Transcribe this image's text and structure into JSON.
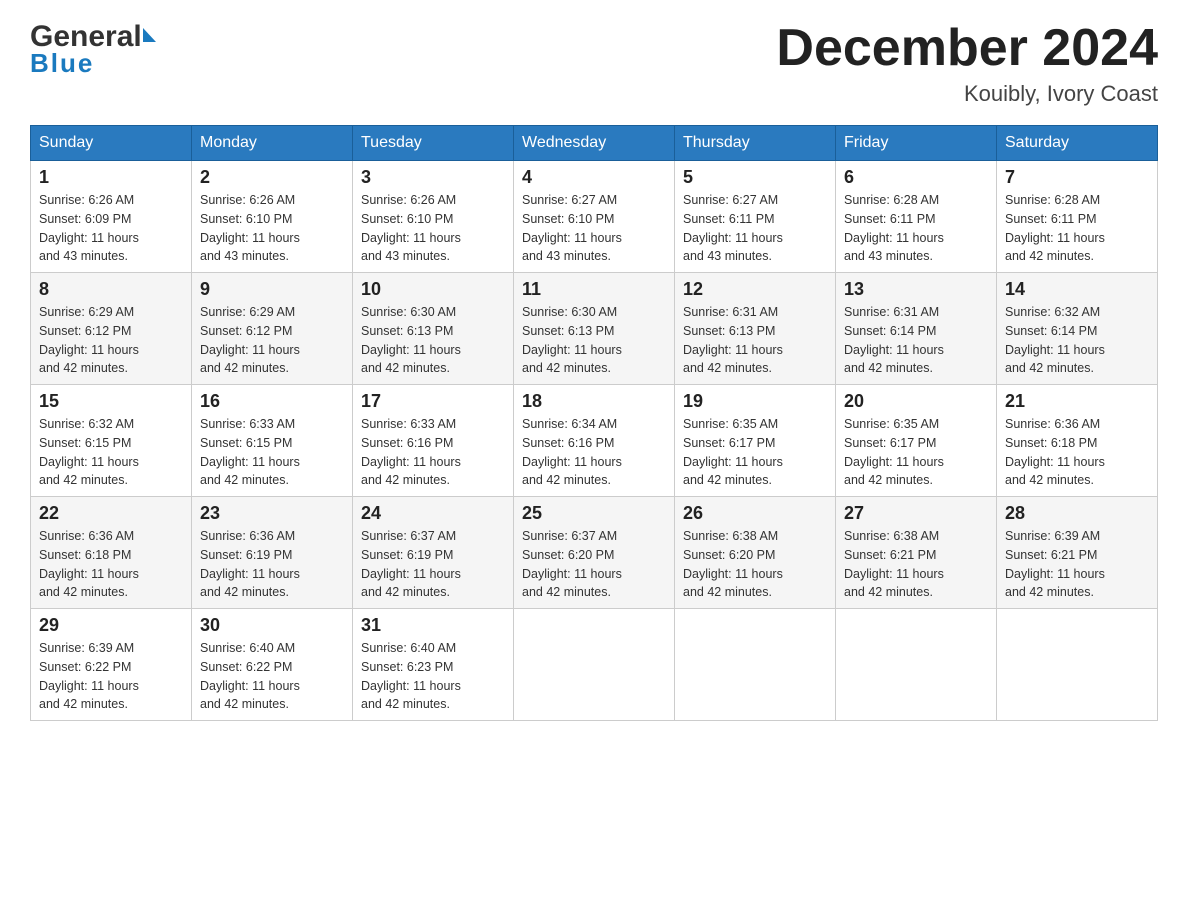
{
  "header": {
    "logo_general": "General",
    "logo_blue": "Blue",
    "title": "December 2024",
    "subtitle": "Kouibly, Ivory Coast"
  },
  "weekdays": [
    "Sunday",
    "Monday",
    "Tuesday",
    "Wednesday",
    "Thursday",
    "Friday",
    "Saturday"
  ],
  "weeks": [
    [
      {
        "day": "1",
        "sunrise": "6:26 AM",
        "sunset": "6:09 PM",
        "daylight": "11 hours and 43 minutes."
      },
      {
        "day": "2",
        "sunrise": "6:26 AM",
        "sunset": "6:10 PM",
        "daylight": "11 hours and 43 minutes."
      },
      {
        "day": "3",
        "sunrise": "6:26 AM",
        "sunset": "6:10 PM",
        "daylight": "11 hours and 43 minutes."
      },
      {
        "day": "4",
        "sunrise": "6:27 AM",
        "sunset": "6:10 PM",
        "daylight": "11 hours and 43 minutes."
      },
      {
        "day": "5",
        "sunrise": "6:27 AM",
        "sunset": "6:11 PM",
        "daylight": "11 hours and 43 minutes."
      },
      {
        "day": "6",
        "sunrise": "6:28 AM",
        "sunset": "6:11 PM",
        "daylight": "11 hours and 43 minutes."
      },
      {
        "day": "7",
        "sunrise": "6:28 AM",
        "sunset": "6:11 PM",
        "daylight": "11 hours and 42 minutes."
      }
    ],
    [
      {
        "day": "8",
        "sunrise": "6:29 AM",
        "sunset": "6:12 PM",
        "daylight": "11 hours and 42 minutes."
      },
      {
        "day": "9",
        "sunrise": "6:29 AM",
        "sunset": "6:12 PM",
        "daylight": "11 hours and 42 minutes."
      },
      {
        "day": "10",
        "sunrise": "6:30 AM",
        "sunset": "6:13 PM",
        "daylight": "11 hours and 42 minutes."
      },
      {
        "day": "11",
        "sunrise": "6:30 AM",
        "sunset": "6:13 PM",
        "daylight": "11 hours and 42 minutes."
      },
      {
        "day": "12",
        "sunrise": "6:31 AM",
        "sunset": "6:13 PM",
        "daylight": "11 hours and 42 minutes."
      },
      {
        "day": "13",
        "sunrise": "6:31 AM",
        "sunset": "6:14 PM",
        "daylight": "11 hours and 42 minutes."
      },
      {
        "day": "14",
        "sunrise": "6:32 AM",
        "sunset": "6:14 PM",
        "daylight": "11 hours and 42 minutes."
      }
    ],
    [
      {
        "day": "15",
        "sunrise": "6:32 AM",
        "sunset": "6:15 PM",
        "daylight": "11 hours and 42 minutes."
      },
      {
        "day": "16",
        "sunrise": "6:33 AM",
        "sunset": "6:15 PM",
        "daylight": "11 hours and 42 minutes."
      },
      {
        "day": "17",
        "sunrise": "6:33 AM",
        "sunset": "6:16 PM",
        "daylight": "11 hours and 42 minutes."
      },
      {
        "day": "18",
        "sunrise": "6:34 AM",
        "sunset": "6:16 PM",
        "daylight": "11 hours and 42 minutes."
      },
      {
        "day": "19",
        "sunrise": "6:35 AM",
        "sunset": "6:17 PM",
        "daylight": "11 hours and 42 minutes."
      },
      {
        "day": "20",
        "sunrise": "6:35 AM",
        "sunset": "6:17 PM",
        "daylight": "11 hours and 42 minutes."
      },
      {
        "day": "21",
        "sunrise": "6:36 AM",
        "sunset": "6:18 PM",
        "daylight": "11 hours and 42 minutes."
      }
    ],
    [
      {
        "day": "22",
        "sunrise": "6:36 AM",
        "sunset": "6:18 PM",
        "daylight": "11 hours and 42 minutes."
      },
      {
        "day": "23",
        "sunrise": "6:36 AM",
        "sunset": "6:19 PM",
        "daylight": "11 hours and 42 minutes."
      },
      {
        "day": "24",
        "sunrise": "6:37 AM",
        "sunset": "6:19 PM",
        "daylight": "11 hours and 42 minutes."
      },
      {
        "day": "25",
        "sunrise": "6:37 AM",
        "sunset": "6:20 PM",
        "daylight": "11 hours and 42 minutes."
      },
      {
        "day": "26",
        "sunrise": "6:38 AM",
        "sunset": "6:20 PM",
        "daylight": "11 hours and 42 minutes."
      },
      {
        "day": "27",
        "sunrise": "6:38 AM",
        "sunset": "6:21 PM",
        "daylight": "11 hours and 42 minutes."
      },
      {
        "day": "28",
        "sunrise": "6:39 AM",
        "sunset": "6:21 PM",
        "daylight": "11 hours and 42 minutes."
      }
    ],
    [
      {
        "day": "29",
        "sunrise": "6:39 AM",
        "sunset": "6:22 PM",
        "daylight": "11 hours and 42 minutes."
      },
      {
        "day": "30",
        "sunrise": "6:40 AM",
        "sunset": "6:22 PM",
        "daylight": "11 hours and 42 minutes."
      },
      {
        "day": "31",
        "sunrise": "6:40 AM",
        "sunset": "6:23 PM",
        "daylight": "11 hours and 42 minutes."
      },
      null,
      null,
      null,
      null
    ]
  ],
  "labels": {
    "sunrise": "Sunrise:",
    "sunset": "Sunset:",
    "daylight": "Daylight:"
  }
}
